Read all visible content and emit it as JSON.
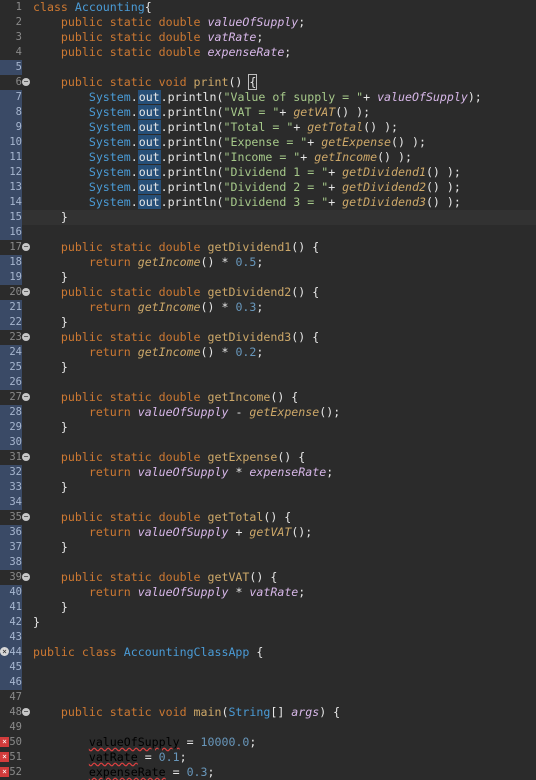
{
  "editor": {
    "language": "Java",
    "lines": [
      {
        "n": "1",
        "fold": false,
        "tokens": [
          [
            "kw",
            "class "
          ],
          [
            "ty",
            "Accounting"
          ],
          [
            "id",
            "{"
          ]
        ]
      },
      {
        "n": "2",
        "tokens": [
          [
            "id",
            "    "
          ],
          [
            "kw",
            "public static double "
          ],
          [
            "fld",
            "valueOfSupply"
          ],
          [
            "id",
            ";"
          ]
        ]
      },
      {
        "n": "3",
        "tokens": [
          [
            "id",
            "    "
          ],
          [
            "kw",
            "public static double "
          ],
          [
            "fld",
            "vatRate"
          ],
          [
            "id",
            ";"
          ]
        ]
      },
      {
        "n": "4",
        "tokens": [
          [
            "id",
            "    "
          ],
          [
            "kw",
            "public static double "
          ],
          [
            "fld",
            "expenseRate"
          ],
          [
            "id",
            ";"
          ]
        ]
      },
      {
        "n": "5",
        "shaded": true,
        "tokens": []
      },
      {
        "n": "6",
        "fold": true,
        "tokens": [
          [
            "id",
            "    "
          ],
          [
            "kw",
            "public static void "
          ],
          [
            "def",
            "print"
          ],
          [
            "id",
            "() "
          ],
          [
            "box",
            "{"
          ]
        ]
      },
      {
        "n": "7",
        "shaded": true,
        "tokens": [
          [
            "id",
            "        "
          ],
          [
            "st",
            "System"
          ],
          [
            "id",
            "."
          ],
          [
            "out",
            "out"
          ],
          [
            "id",
            ".println("
          ],
          [
            "str",
            "\"Value of supply = \""
          ],
          [
            "id",
            "+ "
          ],
          [
            "fld",
            "valueOfSupply"
          ],
          [
            "id",
            ");"
          ]
        ]
      },
      {
        "n": "8",
        "shaded": true,
        "tokens": [
          [
            "id",
            "        "
          ],
          [
            "st",
            "System"
          ],
          [
            "id",
            "."
          ],
          [
            "out",
            "out"
          ],
          [
            "id",
            ".println("
          ],
          [
            "str",
            "\"VAT = \""
          ],
          [
            "id",
            "+ "
          ],
          [
            "mcall",
            "getVAT"
          ],
          [
            "id",
            "() );"
          ]
        ]
      },
      {
        "n": "9",
        "shaded": true,
        "tokens": [
          [
            "id",
            "        "
          ],
          [
            "st",
            "System"
          ],
          [
            "id",
            "."
          ],
          [
            "out",
            "out"
          ],
          [
            "id",
            ".println("
          ],
          [
            "str",
            "\"Total = \""
          ],
          [
            "id",
            "+ "
          ],
          [
            "mcall",
            "getTotal"
          ],
          [
            "id",
            "() );"
          ]
        ]
      },
      {
        "n": "10",
        "shaded": true,
        "tokens": [
          [
            "id",
            "        "
          ],
          [
            "st",
            "System"
          ],
          [
            "id",
            "."
          ],
          [
            "out",
            "out"
          ],
          [
            "id",
            ".println("
          ],
          [
            "str",
            "\"Expense = \""
          ],
          [
            "id",
            "+ "
          ],
          [
            "mcall",
            "getExpense"
          ],
          [
            "id",
            "() );"
          ]
        ]
      },
      {
        "n": "11",
        "shaded": true,
        "tokens": [
          [
            "id",
            "        "
          ],
          [
            "st",
            "System"
          ],
          [
            "id",
            "."
          ],
          [
            "out",
            "out"
          ],
          [
            "id",
            ".println("
          ],
          [
            "str",
            "\"Income = \""
          ],
          [
            "id",
            "+ "
          ],
          [
            "mcall",
            "getIncome"
          ],
          [
            "id",
            "() );"
          ]
        ]
      },
      {
        "n": "12",
        "shaded": true,
        "tokens": [
          [
            "id",
            "        "
          ],
          [
            "st",
            "System"
          ],
          [
            "id",
            "."
          ],
          [
            "out",
            "out"
          ],
          [
            "id",
            ".println("
          ],
          [
            "str",
            "\"Dividend 1 = \""
          ],
          [
            "id",
            "+ "
          ],
          [
            "mcall",
            "getDividend1"
          ],
          [
            "id",
            "() );"
          ]
        ]
      },
      {
        "n": "13",
        "shaded": true,
        "tokens": [
          [
            "id",
            "        "
          ],
          [
            "st",
            "System"
          ],
          [
            "id",
            "."
          ],
          [
            "out",
            "out"
          ],
          [
            "id",
            ".println("
          ],
          [
            "str",
            "\"Dividend 2 = \""
          ],
          [
            "id",
            "+ "
          ],
          [
            "mcall",
            "getDividend2"
          ],
          [
            "id",
            "() );"
          ]
        ]
      },
      {
        "n": "14",
        "shaded": true,
        "tokens": [
          [
            "id",
            "        "
          ],
          [
            "st",
            "System"
          ],
          [
            "id",
            "."
          ],
          [
            "out",
            "out"
          ],
          [
            "id",
            ".println("
          ],
          [
            "str",
            "\"Dividend 3 = \""
          ],
          [
            "id",
            "+ "
          ],
          [
            "mcall",
            "getDividend3"
          ],
          [
            "id",
            "() );"
          ]
        ]
      },
      {
        "n": "15",
        "shaded": true,
        "current": true,
        "tokens": [
          [
            "id",
            "    }"
          ]
        ]
      },
      {
        "n": "16",
        "shaded": true,
        "tokens": []
      },
      {
        "n": "17",
        "fold": true,
        "tokens": [
          [
            "id",
            "    "
          ],
          [
            "kw",
            "public static double "
          ],
          [
            "def",
            "getDividend1"
          ],
          [
            "id",
            "() {"
          ]
        ]
      },
      {
        "n": "18",
        "shaded": true,
        "tokens": [
          [
            "id",
            "        "
          ],
          [
            "kw",
            "return "
          ],
          [
            "mcall",
            "getIncome"
          ],
          [
            "id",
            "() * "
          ],
          [
            "num",
            "0.5"
          ],
          [
            "id",
            ";"
          ]
        ]
      },
      {
        "n": "19",
        "shaded": true,
        "tokens": [
          [
            "id",
            "    }"
          ]
        ]
      },
      {
        "n": "20",
        "fold": true,
        "tokens": [
          [
            "id",
            "    "
          ],
          [
            "kw",
            "public static double "
          ],
          [
            "def",
            "getDividend2"
          ],
          [
            "id",
            "() {"
          ]
        ]
      },
      {
        "n": "21",
        "shaded": true,
        "tokens": [
          [
            "id",
            "        "
          ],
          [
            "kw",
            "return "
          ],
          [
            "mcall",
            "getIncome"
          ],
          [
            "id",
            "() * "
          ],
          [
            "num",
            "0.3"
          ],
          [
            "id",
            ";"
          ]
        ]
      },
      {
        "n": "22",
        "shaded": true,
        "tokens": [
          [
            "id",
            "    }"
          ]
        ]
      },
      {
        "n": "23",
        "fold": true,
        "tokens": [
          [
            "id",
            "    "
          ],
          [
            "kw",
            "public static double "
          ],
          [
            "def",
            "getDividend3"
          ],
          [
            "id",
            "() {"
          ]
        ]
      },
      {
        "n": "24",
        "shaded": true,
        "tokens": [
          [
            "id",
            "        "
          ],
          [
            "kw",
            "return "
          ],
          [
            "mcall",
            "getIncome"
          ],
          [
            "id",
            "() * "
          ],
          [
            "num",
            "0.2"
          ],
          [
            "id",
            ";"
          ]
        ]
      },
      {
        "n": "25",
        "shaded": true,
        "tokens": [
          [
            "id",
            "    }"
          ]
        ]
      },
      {
        "n": "26",
        "shaded": true,
        "tokens": []
      },
      {
        "n": "27",
        "fold": true,
        "tokens": [
          [
            "id",
            "    "
          ],
          [
            "kw",
            "public static double "
          ],
          [
            "def",
            "getIncome"
          ],
          [
            "id",
            "() {"
          ]
        ]
      },
      {
        "n": "28",
        "shaded": true,
        "tokens": [
          [
            "id",
            "        "
          ],
          [
            "kw",
            "return "
          ],
          [
            "fld",
            "valueOfSupply"
          ],
          [
            "id",
            " - "
          ],
          [
            "mcall",
            "getExpense"
          ],
          [
            "id",
            "();"
          ]
        ]
      },
      {
        "n": "29",
        "shaded": true,
        "tokens": [
          [
            "id",
            "    }"
          ]
        ]
      },
      {
        "n": "30",
        "shaded": true,
        "tokens": []
      },
      {
        "n": "31",
        "fold": true,
        "tokens": [
          [
            "id",
            "    "
          ],
          [
            "kw",
            "public static double "
          ],
          [
            "def",
            "getExpense"
          ],
          [
            "id",
            "() {"
          ]
        ]
      },
      {
        "n": "32",
        "shaded": true,
        "tokens": [
          [
            "id",
            "        "
          ],
          [
            "kw",
            "return "
          ],
          [
            "fld",
            "valueOfSupply"
          ],
          [
            "id",
            " * "
          ],
          [
            "fld",
            "expenseRate"
          ],
          [
            "id",
            ";"
          ]
        ]
      },
      {
        "n": "33",
        "shaded": true,
        "tokens": [
          [
            "id",
            "    }"
          ]
        ]
      },
      {
        "n": "34",
        "shaded": true,
        "tokens": []
      },
      {
        "n": "35",
        "fold": true,
        "tokens": [
          [
            "id",
            "    "
          ],
          [
            "kw",
            "public static double "
          ],
          [
            "def",
            "getTotal"
          ],
          [
            "id",
            "() {"
          ]
        ]
      },
      {
        "n": "36",
        "shaded": true,
        "tokens": [
          [
            "id",
            "        "
          ],
          [
            "kw",
            "return "
          ],
          [
            "fld",
            "valueOfSupply"
          ],
          [
            "id",
            " + "
          ],
          [
            "mcall",
            "getVAT"
          ],
          [
            "id",
            "();"
          ]
        ]
      },
      {
        "n": "37",
        "shaded": true,
        "tokens": [
          [
            "id",
            "    }"
          ]
        ]
      },
      {
        "n": "38",
        "shaded": true,
        "tokens": []
      },
      {
        "n": "39",
        "fold": true,
        "tokens": [
          [
            "id",
            "    "
          ],
          [
            "kw",
            "public static double "
          ],
          [
            "def",
            "getVAT"
          ],
          [
            "id",
            "() {"
          ]
        ]
      },
      {
        "n": "40",
        "shaded": true,
        "tokens": [
          [
            "id",
            "        "
          ],
          [
            "kw",
            "return "
          ],
          [
            "fld",
            "valueOfSupply"
          ],
          [
            "id",
            " * "
          ],
          [
            "fld",
            "vatRate"
          ],
          [
            "id",
            ";"
          ]
        ]
      },
      {
        "n": "41",
        "shaded": true,
        "tokens": [
          [
            "id",
            "    }"
          ]
        ]
      },
      {
        "n": "42",
        "shaded": true,
        "tokens": [
          [
            "id",
            "}"
          ]
        ]
      },
      {
        "n": "43",
        "shaded": true,
        "tokens": []
      },
      {
        "n": "44",
        "warn": true,
        "shaded": true,
        "tokens": [
          [
            "kw",
            "public class "
          ],
          [
            "ty",
            "AccountingClassApp"
          ],
          [
            "id",
            " {"
          ]
        ]
      },
      {
        "n": "45",
        "shaded": true,
        "tokens": []
      },
      {
        "n": "46",
        "shaded": true,
        "tokens": []
      },
      {
        "n": "47",
        "tokens": []
      },
      {
        "n": "48",
        "fold": true,
        "tokens": [
          [
            "id",
            "    "
          ],
          [
            "kw",
            "public static void "
          ],
          [
            "def",
            "main"
          ],
          [
            "id",
            "("
          ],
          [
            "ty",
            "String"
          ],
          [
            "id",
            "[] "
          ],
          [
            "fld",
            "args"
          ],
          [
            "id",
            ") {"
          ]
        ]
      },
      {
        "n": "49",
        "tokens": []
      },
      {
        "n": "50",
        "error": true,
        "tokens": [
          [
            "id",
            "        "
          ],
          [
            "err",
            "valueOfSupply"
          ],
          [
            "id",
            " = "
          ],
          [
            "num",
            "10000.0"
          ],
          [
            "id",
            ";"
          ]
        ]
      },
      {
        "n": "51",
        "error": true,
        "tokens": [
          [
            "id",
            "        "
          ],
          [
            "err",
            "vatRate"
          ],
          [
            "id",
            " = "
          ],
          [
            "num",
            "0.1"
          ],
          [
            "id",
            ";"
          ]
        ]
      },
      {
        "n": "52",
        "error": true,
        "tokens": [
          [
            "id",
            "        "
          ],
          [
            "err",
            "expenseRate"
          ],
          [
            "id",
            " = "
          ],
          [
            "num",
            "0.3"
          ],
          [
            "id",
            ";"
          ]
        ]
      }
    ]
  }
}
